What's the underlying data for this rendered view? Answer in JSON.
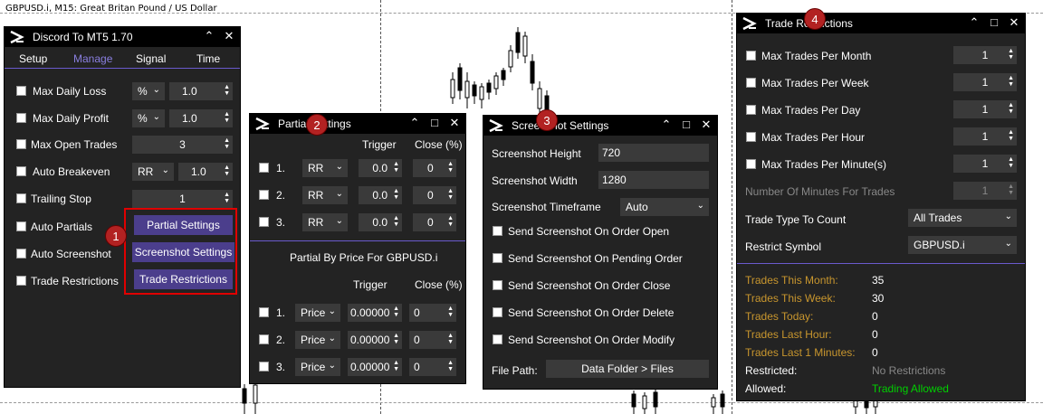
{
  "chart": {
    "title": "GBPUSD.i, M15:  Great Britan Pound / US Dollar"
  },
  "main": {
    "title": "Discord To MT5 1.70",
    "tabs": [
      "Setup",
      "Manage",
      "Signal",
      "Time"
    ],
    "rows": {
      "max_daily_loss": {
        "label": "Max Daily Loss",
        "mode": "%",
        "value": "1.0"
      },
      "max_daily_profit": {
        "label": "Max Daily Profit",
        "mode": "%",
        "value": "1.0"
      },
      "max_open_trades": {
        "label": "Max Open Trades",
        "value": "3"
      },
      "auto_breakeven": {
        "label": "Auto Breakeven",
        "mode": "RR",
        "value": "1.0"
      },
      "trailing_stop": {
        "label": "Trailing Stop",
        "value": "1"
      },
      "auto_partials": {
        "label": "Auto Partials",
        "button": "Partial Settings"
      },
      "auto_screenshot": {
        "label": "Auto Screenshot",
        "button": "Screenshot Settings"
      },
      "trade_restrictions": {
        "label": "Trade Restrictions",
        "button": "Trade Restrictions"
      }
    }
  },
  "partial": {
    "title": "Partial Settings",
    "hdr_trigger": "Trigger",
    "hdr_close": "Close (%)",
    "rows": [
      {
        "num": "1.",
        "mode": "RR",
        "trigger": "0.0",
        "close": "0"
      },
      {
        "num": "2.",
        "mode": "RR",
        "trigger": "0.0",
        "close": "0"
      },
      {
        "num": "3.",
        "mode": "RR",
        "trigger": "0.0",
        "close": "0"
      }
    ],
    "price_title": "Partial By Price For GBPUSD.i",
    "price_rows": [
      {
        "num": "1.",
        "mode": "Price",
        "trigger": "0.00000",
        "close": "0"
      },
      {
        "num": "2.",
        "mode": "Price",
        "trigger": "0.00000",
        "close": "0"
      },
      {
        "num": "3.",
        "mode": "Price",
        "trigger": "0.00000",
        "close": "0"
      }
    ]
  },
  "screenshot": {
    "title": "Screenshot Settings",
    "height_label": "Screenshot Height",
    "height_value": "720",
    "width_label": "Screenshot Width",
    "width_value": "1280",
    "tf_label": "Screenshot Timeframe",
    "tf_value": "Auto",
    "options": [
      "Send Screenshot On Order Open",
      "Send Screenshot On Pending Order",
      "Send Screenshot On Order Close",
      "Send Screenshot On Order Delete",
      "Send Screenshot On Order Modify"
    ],
    "path_label": "File Path:",
    "path_value": "Data Folder > Files"
  },
  "restrictions": {
    "title": "Trade Restrictions",
    "rows": [
      {
        "label": "Max Trades Per Month",
        "value": "1"
      },
      {
        "label": "Max Trades Per Week",
        "value": "1"
      },
      {
        "label": "Max Trades Per Day",
        "value": "1"
      },
      {
        "label": "Max Trades Per Hour",
        "value": "1"
      },
      {
        "label": "Max Trades Per Minute(s)",
        "value": "1"
      }
    ],
    "minutes_label": "Number Of Minutes For Trades",
    "minutes_value": "1",
    "type_label": "Trade Type To Count",
    "type_value": "All Trades",
    "symbol_label": "Restrict Symbol",
    "symbol_value": "GBPUSD.i",
    "stats": [
      {
        "label": "Trades This Month:",
        "value": "35"
      },
      {
        "label": "Trades This Week:",
        "value": "30"
      },
      {
        "label": "Trades Today:",
        "value": "0"
      },
      {
        "label": "Trades Last Hour:",
        "value": "0"
      },
      {
        "label": "Trades Last 1 Minutes:",
        "value": "0"
      }
    ],
    "restricted_label": "Restricted:",
    "restricted_value": "No Restrictions",
    "allowed_label": "Allowed:",
    "allowed_value": "Trading Allowed"
  },
  "badges": [
    "1",
    "2",
    "3",
    "4"
  ],
  "colors": {
    "accent": "#4b3e8c",
    "gold": "#c8962e",
    "allowed": "#00d000",
    "highlight": "#e00000"
  }
}
